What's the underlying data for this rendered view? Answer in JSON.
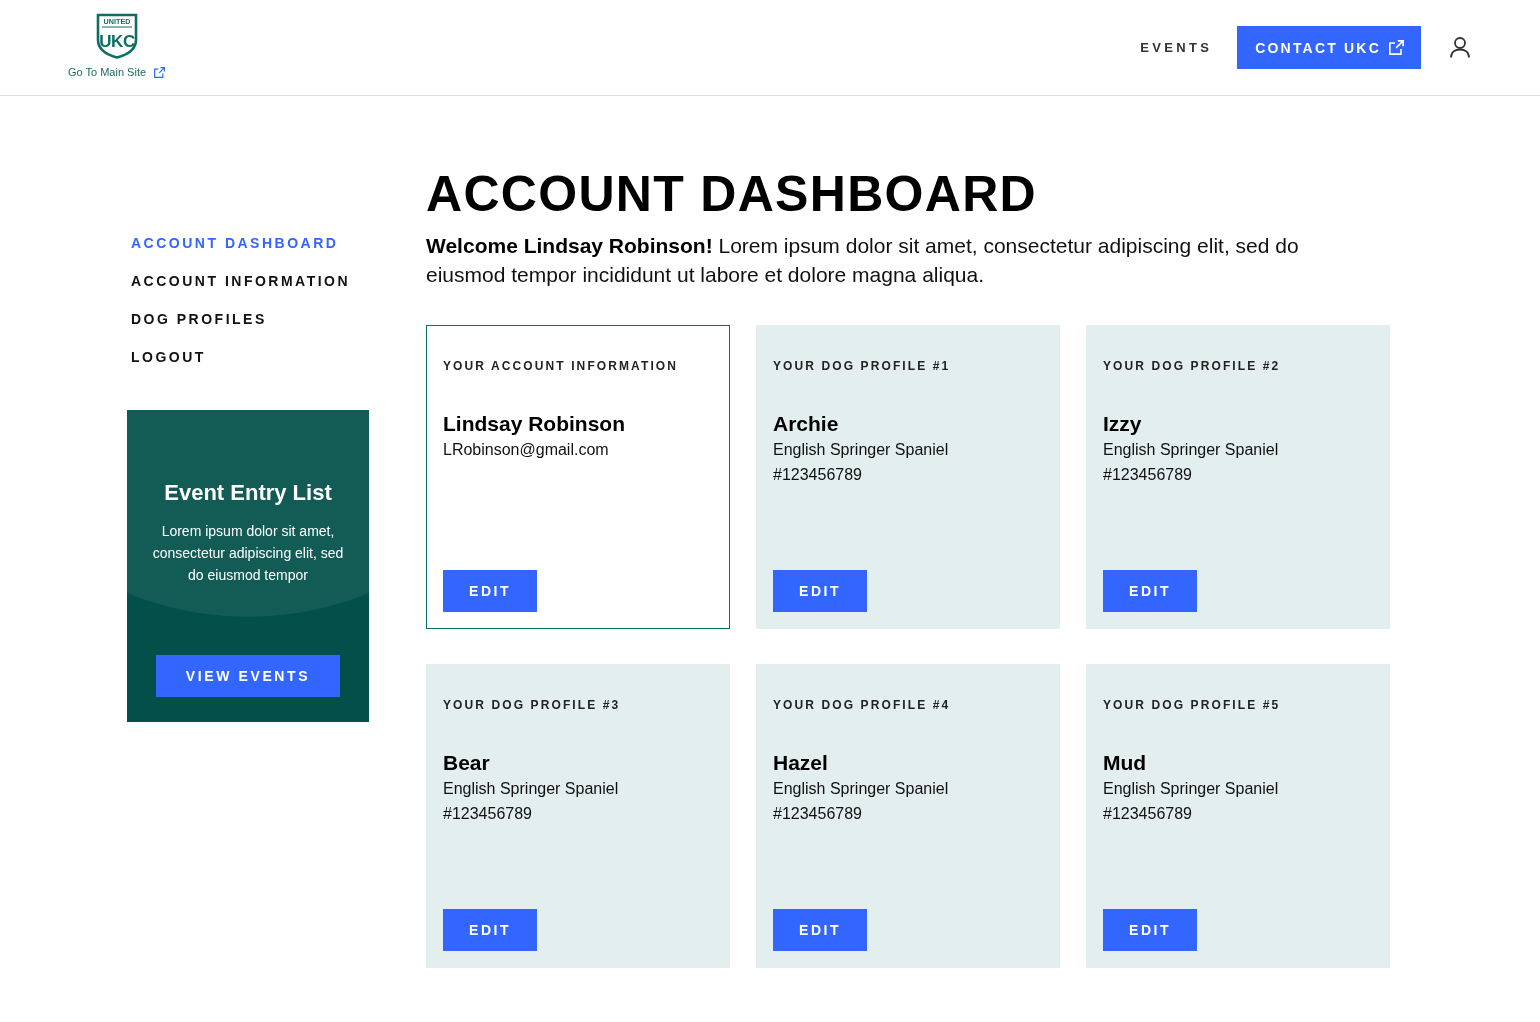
{
  "header": {
    "logo": {
      "top_text": "UNITED",
      "mark": "UKC"
    },
    "main_site_link": "Go To Main Site",
    "nav": [
      {
        "kind": "link",
        "label": "EVENTS"
      },
      {
        "kind": "button",
        "label": "CONTACT UKC"
      }
    ]
  },
  "sidebar": {
    "items": [
      {
        "label": "ACCOUNT DASHBOARD",
        "selected": true
      },
      {
        "label": "ACCOUNT INFORMATION",
        "selected": false
      },
      {
        "label": "DOG PROFILES",
        "selected": false
      },
      {
        "label": "LOGOUT",
        "selected": false
      }
    ],
    "promo": {
      "title": "Event Entry List",
      "text": "Lorem ipsum dolor sit amet, consectetur adipiscing elit, sed do eiusmod tempor",
      "button": "VIEW EVENTS"
    }
  },
  "main": {
    "title": "ACCOUNT DASHBOARD",
    "welcome": "**Welcome Lindsay Robinson!** Lorem ipsum dolor sit amet, consectetur adipiscing elit, sed do eiusmod tempor incididunt ut labore et dolore magna aliqua.",
    "cards": [
      {
        "kind": "account",
        "label": "YOUR ACCOUNT INFORMATION",
        "name": "Lindsay Robinson",
        "lines": [
          "LRobinson@gmail.com"
        ],
        "button": "EDIT"
      },
      {
        "kind": "dog",
        "label": "YOUR DOG PROFILE #1",
        "name": "Archie",
        "lines": [
          "English Springer Spaniel",
          "#123456789"
        ],
        "button": "EDIT"
      },
      {
        "kind": "dog",
        "label": "YOUR DOG PROFILE #2",
        "name": "Izzy",
        "lines": [
          "English Springer Spaniel",
          "#123456789"
        ],
        "button": "EDIT"
      },
      {
        "kind": "dog",
        "label": "YOUR DOG PROFILE #3",
        "name": "Bear",
        "lines": [
          "English Springer Spaniel",
          "#123456789"
        ],
        "button": "EDIT"
      },
      {
        "kind": "dog",
        "label": "YOUR DOG PROFILE #4",
        "name": "Hazel",
        "lines": [
          "English Springer Spaniel",
          "#123456789"
        ],
        "button": "EDIT"
      },
      {
        "kind": "dog",
        "label": "YOUR DOG PROFILE #5",
        "name": "Mud",
        "lines": [
          "English Springer Spaniel",
          "#123456789"
        ],
        "button": "EDIT"
      }
    ]
  }
}
